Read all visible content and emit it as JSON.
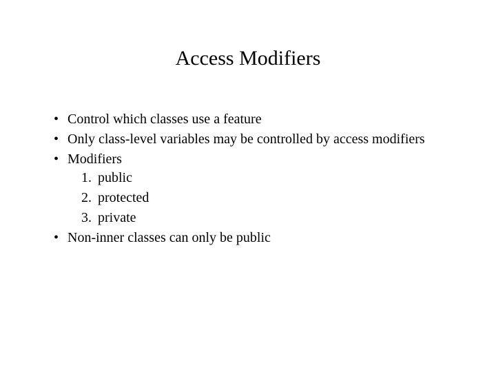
{
  "title": "Access Modifiers",
  "bullets": {
    "b0": "Control which classes use a feature",
    "b1": "Only class-level variables may be controlled by access modifiers",
    "b2": "Modifiers",
    "b3": "Non-inner classes can only be public"
  },
  "modifiers": {
    "m0": "public",
    "m1": "protected",
    "m2": "private"
  }
}
